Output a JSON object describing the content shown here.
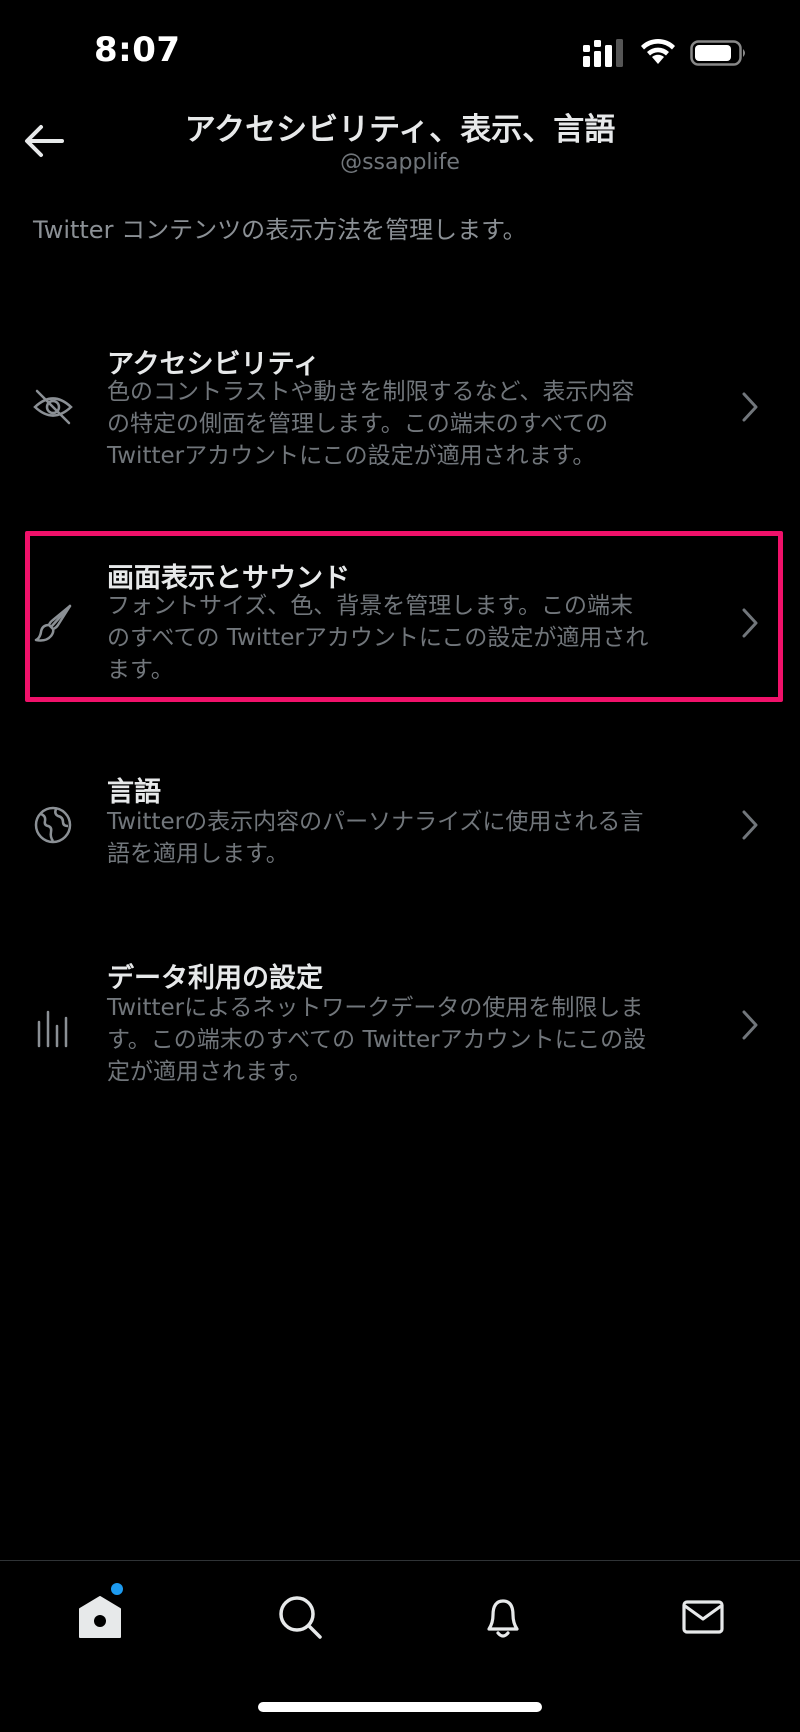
{
  "status_bar": {
    "time": "8:07"
  },
  "header": {
    "title": "アクセシビリティ、表示、言語",
    "subtitle": "@ssapplife"
  },
  "description": "Twitter コンテンツの表示方法を管理します。",
  "items": [
    {
      "title": "アクセシビリティ",
      "desc_lines": [
        "色のコントラストや動きを制限するなど、表示内容",
        "の特定の側面を管理します。この端末のすべての",
        "Twitterアカウントにこの設定が適用されます。"
      ],
      "icon": "eye-off-icon"
    },
    {
      "title": "画面表示とサウンド",
      "desc_lines": [
        "フォントサイズ、色、背景を管理します。この端末",
        "のすべての Twitterアカウントにこの設定が適用され",
        "ます。"
      ],
      "icon": "paintbrush-icon",
      "highlighted": true
    },
    {
      "title": "言語",
      "desc_lines": [
        "Twitterの表示内容のパーソナライズに使用される言",
        "語を適用します。"
      ],
      "icon": "globe-icon"
    },
    {
      "title": "データ利用の設定",
      "desc_lines": [
        "Twitterによるネットワークデータの使用を制限しま",
        "す。この端末のすべての Twitterアカウントにこの設",
        "定が適用されます。"
      ],
      "icon": "data-bars-icon"
    }
  ],
  "tab_bar": {
    "tabs": [
      "home-icon",
      "search-icon",
      "bell-icon",
      "mail-icon"
    ],
    "home_has_notification": true
  },
  "colors": {
    "background": "#000000",
    "primary_text": "#e7e9ea",
    "secondary_text": "#71767b",
    "highlight": "#f0116a",
    "accent": "#1d9bf0"
  }
}
